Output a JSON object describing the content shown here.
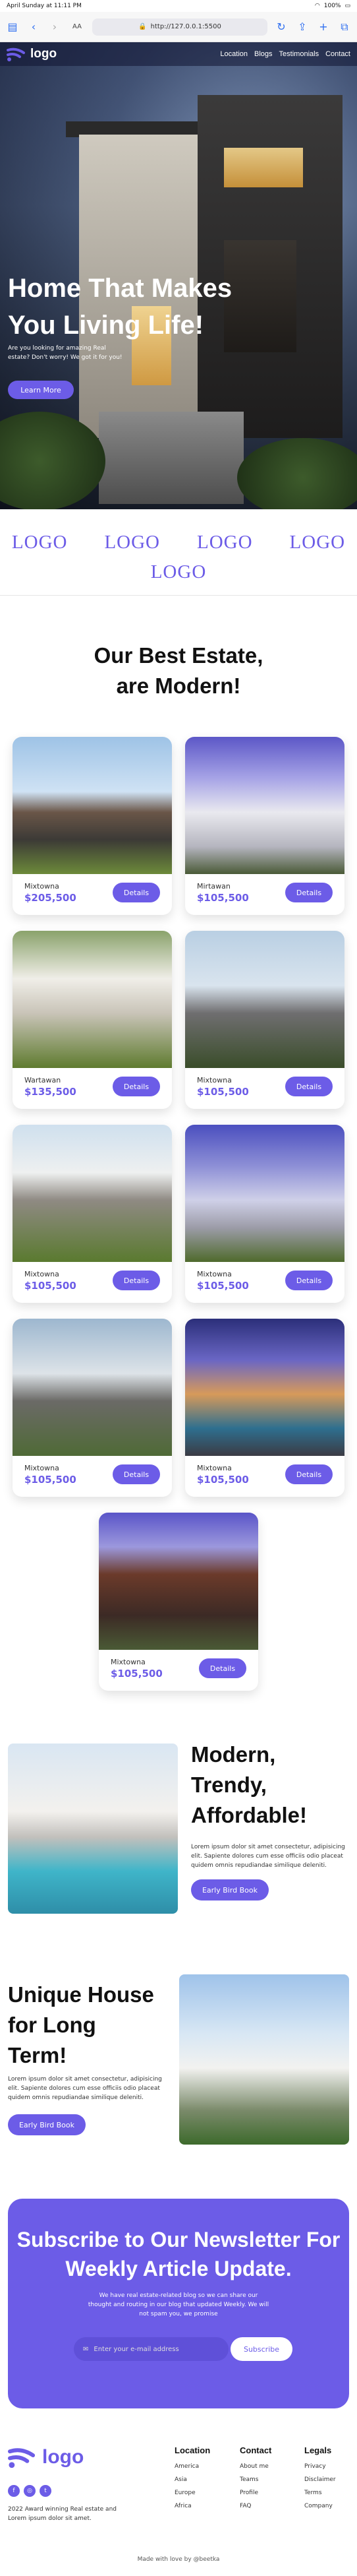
{
  "status": {
    "time": "April Sunday at 11:11 PM",
    "battery": "100%"
  },
  "browser": {
    "aa": "AA",
    "url": "http://127.0.0.1:5500"
  },
  "nav": {
    "logo": "logo",
    "links": [
      "Location",
      "Blogs",
      "Testimonials",
      "Contact"
    ]
  },
  "hero": {
    "title": "Home That Makes You Living Life!",
    "subtitle": "Are you looking for amazing Real estate? Don't worry! We got it for you!",
    "button": "Learn More"
  },
  "logos": [
    "LOGO",
    "LOGO",
    "LOGO",
    "LOGO",
    "LOGO"
  ],
  "estate": {
    "title": "Our Best Estate, are Modern!"
  },
  "cards": [
    {
      "location": "Mixtowna",
      "price": "$205,500",
      "button": "Details"
    },
    {
      "location": "Mirtawan",
      "price": "$105,500",
      "button": "Details"
    },
    {
      "location": "Wartawan",
      "price": "$135,500",
      "button": "Details"
    },
    {
      "location": "Mixtowna",
      "price": "$105,500",
      "button": "Details"
    },
    {
      "location": "Mixtowna",
      "price": "$105,500",
      "button": "Details"
    },
    {
      "location": "Mixtowna",
      "price": "$105,500",
      "button": "Details"
    },
    {
      "location": "Mixtowna",
      "price": "$105,500",
      "button": "Details"
    },
    {
      "location": "Mixtowna",
      "price": "$105,500",
      "button": "Details"
    },
    {
      "location": "Mixtowna",
      "price": "$105,500",
      "button": "Details"
    }
  ],
  "feature1": {
    "title": "Modern, Trendy, Affordable!",
    "text": "Lorem ipsum dolor sit amet consectetur, adipisicing elit. Sapiente dolores cum esse officiis odio placeat quidem omnis repudiandae similique deleniti.",
    "button": "Early Bird Book"
  },
  "feature2": {
    "title": "Unique House for Long Term!",
    "text": "Lorem ipsum dolor sit amet consectetur, adipisicing elit. Sapiente dolores cum esse officiis odio placeat quidem omnis repudiandae similique deleniti.",
    "button": "Early Bird Book"
  },
  "newsletter": {
    "title": "Subscribe to Our Newsletter For Weekly Article Update.",
    "text": "We have real estate-related blog so we can share our thought and routing in our blog that updated Weekly. We will not spam you, we promise",
    "placeholder": "Enter your e-mail address",
    "button": "Subscribe"
  },
  "footer": {
    "logo": "logo",
    "description": "2022 Award winning Real estate and Lorem ipsum dolor sit amet.",
    "columns": [
      {
        "title": "Location",
        "items": [
          "America",
          "Asia",
          "Europe",
          "Africa"
        ]
      },
      {
        "title": "Contact",
        "items": [
          "About me",
          "Teams",
          "Profile",
          "FAQ"
        ]
      },
      {
        "title": "Legals",
        "items": [
          "Privacy",
          "Disclaimer",
          "Terms",
          "Company"
        ]
      }
    ],
    "made": "Made with love by @beetka"
  },
  "colors": {
    "accent": "#6c5ce7"
  }
}
